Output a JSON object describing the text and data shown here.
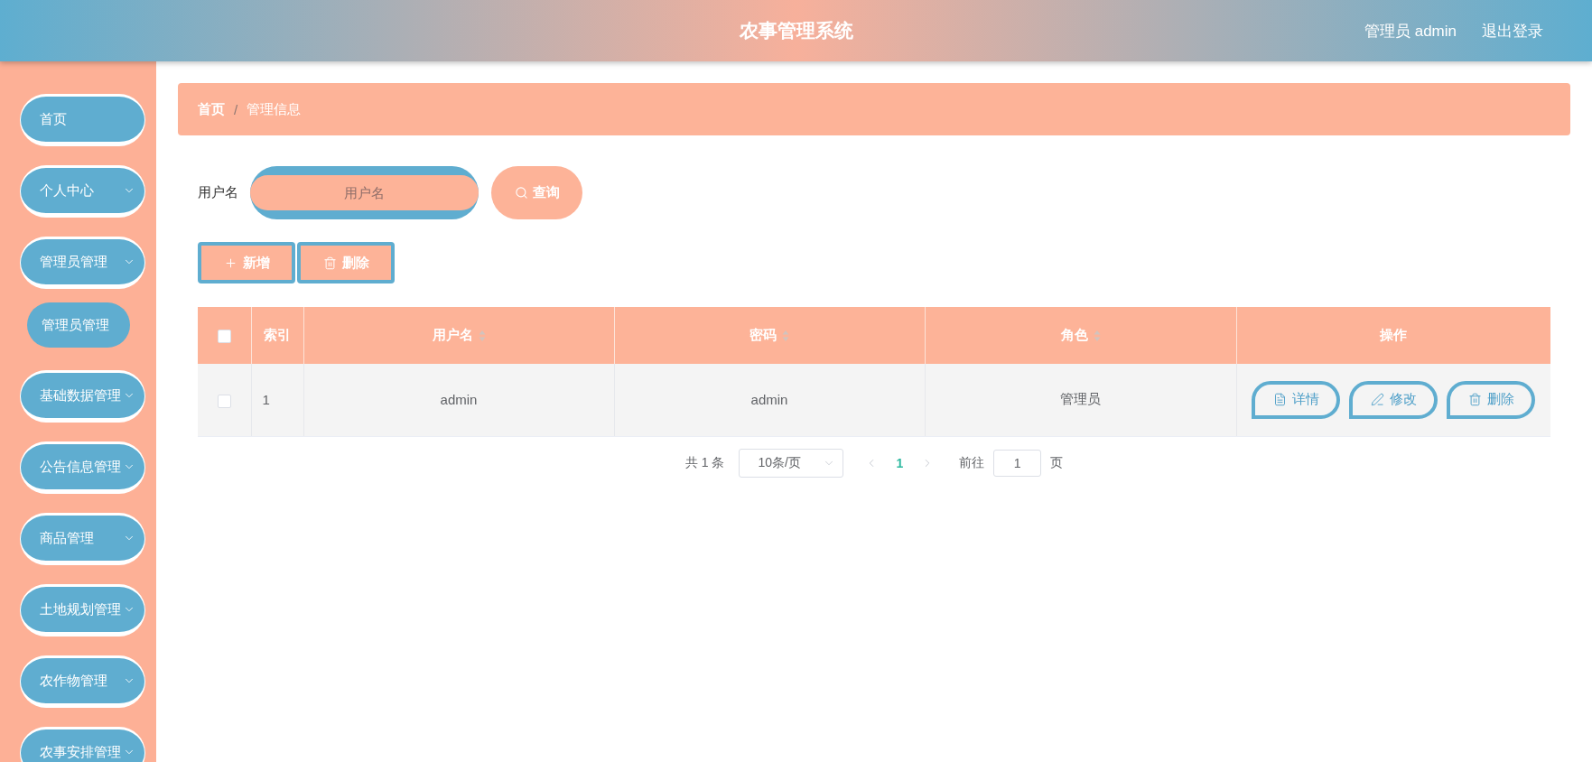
{
  "header": {
    "title": "农事管理系统",
    "user": "管理员 admin",
    "logout": "退出登录"
  },
  "sidebar": {
    "items": [
      {
        "label": "首页",
        "kind": "link"
      },
      {
        "label": "个人中心",
        "kind": "submenu"
      },
      {
        "label": "管理员管理",
        "kind": "submenu",
        "children": [
          {
            "label": "管理员管理"
          }
        ]
      },
      {
        "label": "基础数据管理",
        "kind": "submenu"
      },
      {
        "label": "公告信息管理",
        "kind": "submenu"
      },
      {
        "label": "商品管理",
        "kind": "submenu"
      },
      {
        "label": "土地规划管理",
        "kind": "submenu"
      },
      {
        "label": "农作物管理",
        "kind": "submenu"
      },
      {
        "label": "农事安排管理",
        "kind": "submenu"
      }
    ]
  },
  "breadcrumb": {
    "items": [
      "首页",
      "管理信息"
    ],
    "separator": "/"
  },
  "search": {
    "label": "用户名",
    "placeholder": "用户名",
    "button": "查询"
  },
  "toolbar": [
    {
      "label": "新增",
      "kind": "add"
    },
    {
      "label": "删除",
      "kind": "delete"
    }
  ],
  "table": {
    "all_checked": false,
    "columns": [
      {
        "label": "索引",
        "sortable": false
      },
      {
        "label": "用户名",
        "sortable": true
      },
      {
        "label": "密码",
        "sortable": true
      },
      {
        "label": "角色",
        "sortable": true
      },
      {
        "label": "操作",
        "sortable": false
      }
    ],
    "rows": [
      {
        "checked": false,
        "cells": [
          "1",
          "admin",
          "admin",
          "管理员"
        ],
        "actions": [
          {
            "label": "详情",
            "kind": "detail"
          },
          {
            "label": "修改",
            "kind": "edit"
          },
          {
            "label": "删除",
            "kind": "delete"
          }
        ]
      }
    ]
  },
  "pagination": {
    "total": "共 1 条",
    "page_size": "10条/页",
    "pages": [
      {
        "label": "1",
        "selected": true
      }
    ],
    "goto_label": "前往",
    "goto_value": "1",
    "goto_suffix": "页"
  }
}
